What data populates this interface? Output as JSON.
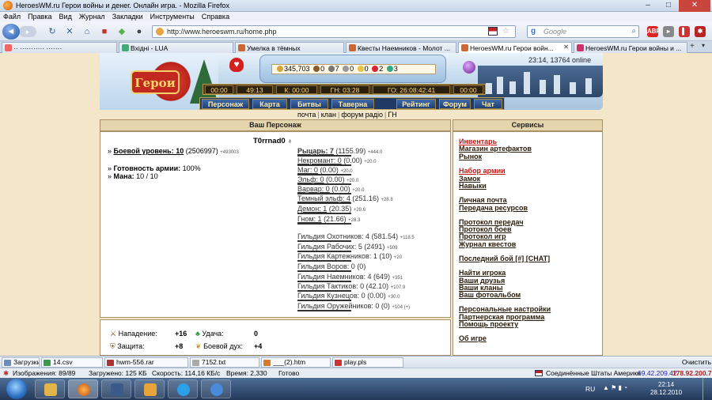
{
  "window": {
    "title": "HeroesWM.ru Герои войны и денег. Онлайн игра. - Mozilla Firefox",
    "min": "–",
    "max": "□",
    "close": "✕"
  },
  "menu": [
    "Файл",
    "Правка",
    "Вид",
    "Журнал",
    "Закладки",
    "Инструменты",
    "Справка"
  ],
  "nav": {
    "url": "http://www.heroeswm.ru/home.php",
    "search_placeholder": "Google"
  },
  "tabs": [
    {
      "label": "·· ··········· ·······"
    },
    {
      "label": "Вхідні - LUA"
    },
    {
      "label": "Умелка в тёмных"
    },
    {
      "label": "Квесты Наемников - Молот ..."
    },
    {
      "label": "HeroesWM.ru Герои войн..."
    },
    {
      "label": "HeroesWM.ru Герои войны и ..."
    }
  ],
  "game": {
    "online": "23:14, 13764 online",
    "resources": [
      "345,703",
      "0",
      "7",
      "0",
      "0",
      "2",
      "3"
    ],
    "timers": [
      "00:00",
      "49:13",
      "К: 00:00",
      "ГН: 03:28",
      "ГО: 26:08:42:41",
      "00:00"
    ],
    "menu": [
      "Персонаж",
      "Карта",
      "Битвы",
      "Таверна",
      "Рейтинг",
      "Форум",
      "Чат"
    ],
    "sublinks": [
      "почта",
      "клан",
      "форум радіо",
      "ГН"
    ],
    "char_header": "Ваш Персонаж",
    "services_header": "Сервисы",
    "char_name": "T0rrnad0",
    "level_label": "Боевой уровень: 10",
    "level_exp": "(2506997)",
    "level_small": "+493003",
    "army_label": "Готовность армии:",
    "army_value": "100%",
    "mana_label": "Мана:",
    "mana_value": "10 / 10",
    "factions": [
      {
        "name": "Рыцарь: 7",
        "val": "(1155.99)",
        "plus": "+444.0",
        "bold": true
      },
      {
        "name": "Некромант: 0",
        "val": "(0.00)",
        "plus": "+20.0"
      },
      {
        "name": "Маг: 0",
        "val": "(0.00)",
        "plus": "+20.0"
      },
      {
        "name": "Эльф: 0",
        "val": "(0.00)",
        "plus": "+20.0"
      },
      {
        "name": "Варвар: 0",
        "val": "(0.00)",
        "plus": "+20.0"
      },
      {
        "name": "Темный эльф: 4",
        "val": "(251.16)",
        "plus": "+28.8"
      },
      {
        "name": "Демон: 1",
        "val": "(20.35)",
        "plus": "+29.6"
      },
      {
        "name": "Гном: 1",
        "val": "(21.66)",
        "plus": "+28.3"
      }
    ],
    "guilds": [
      {
        "name": "Гильдия Охотников: 4",
        "val": "(581.54)",
        "plus": "+118.5"
      },
      {
        "name": "Гильдия Рабочих: 5",
        "val": "(2491)",
        "plus": "+509"
      },
      {
        "name": "Гильдия Картежников: 1",
        "val": "(10)",
        "plus": "+20"
      },
      {
        "name": "Гильдия Воров: 0",
        "val": "(0)",
        "plus": ""
      },
      {
        "name": "Гильдия Наемников: 4",
        "val": "(649)",
        "plus": "+351"
      },
      {
        "name": "Гильдия Тактиков: 0",
        "val": "(42.10)",
        "plus": "+107.9"
      },
      {
        "name": "Гильдия Кузнецов: 0",
        "val": "(0.00)",
        "plus": "+30.0"
      },
      {
        "name": "Гильдия Оружейников: 0",
        "val": "(0)",
        "plus": "+104 (+)"
      }
    ],
    "services": [
      {
        "label": "Инвентарь",
        "red": true
      },
      {
        "label": "Магазин артефактов"
      },
      {
        "label": "Рынок"
      },
      {
        "label": "Набор армии",
        "red": true
      },
      {
        "label": "Замок"
      },
      {
        "label": "Навыки"
      },
      {
        "label": "Личная почта"
      },
      {
        "label": "Передача ресурсов"
      },
      {
        "label": "Протокол передач"
      },
      {
        "label": "Протокол боев"
      },
      {
        "label": "Протокол игр"
      },
      {
        "label": "Журнал квестов"
      },
      {
        "label": "Последний бой [#] [CHAT]"
      },
      {
        "label": "Найти игрока"
      },
      {
        "label": "Ваши друзья"
      },
      {
        "label": "Ваши кланы"
      },
      {
        "label": "Ваш фотоальбом"
      },
      {
        "label": "Персональные настройки"
      },
      {
        "label": "Партнерская программа"
      },
      {
        "label": "Помощь проекту"
      },
      {
        "label": "Об игре"
      }
    ],
    "stats": {
      "attack_label": "Нападение:",
      "attack": "+16",
      "luck_label": "Удача:",
      "luck": "0",
      "defense_label": "Защита:",
      "defense": "+8",
      "morale_label": "Боевой дух:",
      "morale": "+4"
    }
  },
  "downloads": {
    "label": "Загрузки",
    "files": [
      "14.csv",
      "hwm-556.rar",
      "7152.txt",
      "___(2).htm",
      "play.pls"
    ],
    "clear": "Очистить"
  },
  "status": {
    "images": "Изображения: 89/89",
    "loaded": "Загружено: 125 КБ",
    "speed": "Скорость: 114,16 КБ/с",
    "time": "Время: 2,330",
    "done": "Готово",
    "country": "Соединённые Штаты Америки",
    "ip1": "69.42.209.42",
    "ip2": "178.92.200.76"
  },
  "taskbar": {
    "lang": "RU",
    "time": "22:14",
    "date": "28.12.2010"
  }
}
